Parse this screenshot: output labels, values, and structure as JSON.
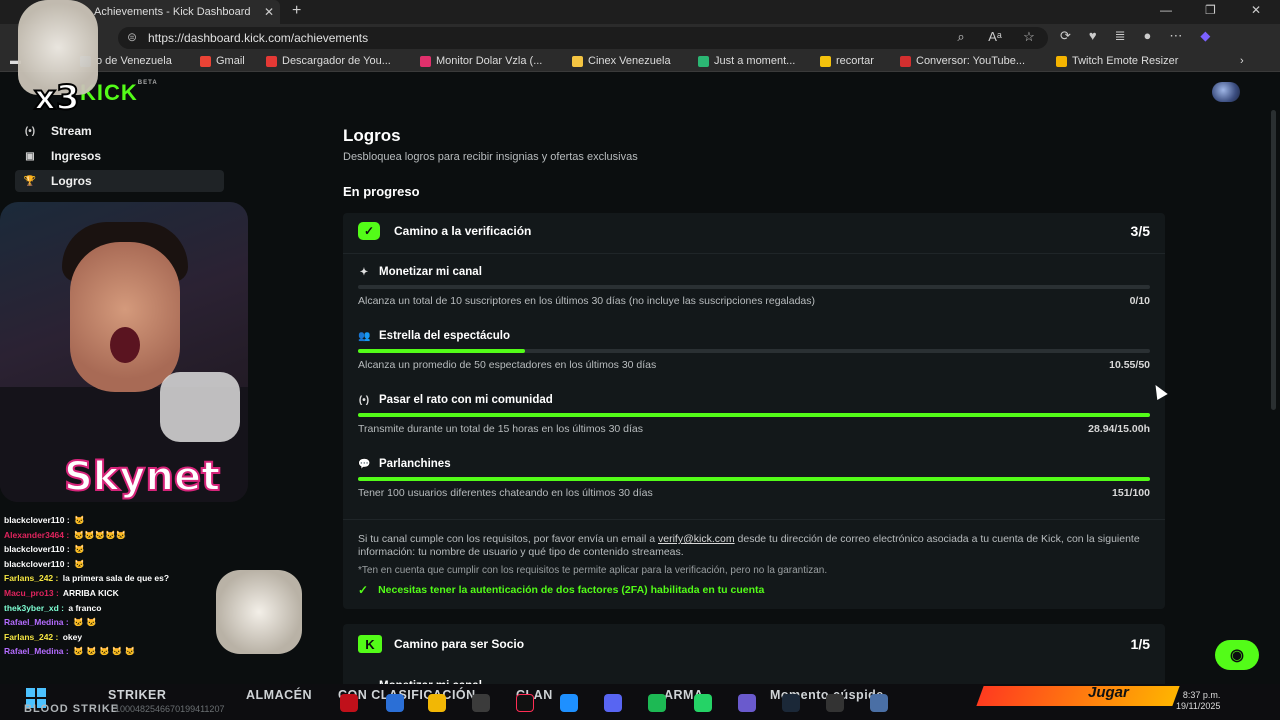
{
  "browser": {
    "tab_title": "Achievements - Kick Dashboard",
    "tab_close": "✕",
    "new_tab": "+",
    "url": "https://dashboard.kick.com/achievements",
    "bookmarks": [
      {
        "label": "o de Venezuela",
        "color": "#3a7bd5"
      },
      {
        "label": "Gmail",
        "color": "#ea4335"
      },
      {
        "label": "Descargador de You...",
        "color": "#e53935"
      },
      {
        "label": "Monitor Dolar Vzla (...",
        "color": "#e1306c"
      },
      {
        "label": "Cinex Venezuela",
        "color": "#f5c542"
      },
      {
        "label": "Just a moment...",
        "color": "#2bb673"
      },
      {
        "label": "recortar",
        "color": "#f4c20d"
      },
      {
        "label": "Conversor: YouTube...",
        "color": "#d32f2f"
      },
      {
        "label": "Twitch Emote Resizer",
        "color": "#f4b400"
      }
    ]
  },
  "sidebar": {
    "brand": "KICK",
    "brand_tag": "BETA",
    "items": [
      {
        "label": "Stream",
        "icon": "broadcast-icon",
        "glyph": "(•)"
      },
      {
        "label": "Ingresos",
        "icon": "income-icon",
        "glyph": "▣"
      },
      {
        "label": "Logros",
        "icon": "trophy-icon",
        "glyph": "🏆",
        "active": true
      }
    ]
  },
  "main": {
    "title": "Logros",
    "subtitle": "Desbloquea logros para recibir insignias y ofertas exclusivas",
    "section": "En progreso",
    "card1": {
      "title": "Camino a la verificación",
      "count": "3/5",
      "achievements": [
        {
          "title": "Monetizar mi canal",
          "icon": "sparkle-icon",
          "glyph": "✦",
          "progress": 0.0,
          "desc": "Alcanza un total de 10 suscriptores en los últimos 30 días (no incluye las suscripciones regaladas)",
          "value": "0/10"
        },
        {
          "title": "Estrella del espectáculo",
          "icon": "users-icon",
          "glyph": "👥",
          "progress": 0.211,
          "desc": "Alcanza un promedio de 50 espectadores en los últimos 30 días",
          "value": "10.55/50"
        },
        {
          "title": "Pasar el rato con mi comunidad",
          "icon": "broadcast-icon",
          "glyph": "(•)",
          "progress": 1.0,
          "desc": "Transmite durante un total de 15 horas en los últimos 30 días",
          "value": "28.94/15.00h"
        },
        {
          "title": "Parlanchines",
          "icon": "chat-bubble-icon",
          "glyph": "💬",
          "progress": 1.0,
          "desc": "Tener 100 usuarios diferentes chateando en los últimos 30 días",
          "value": "151/100"
        }
      ],
      "note_before": "Si tu canal cumple con los requisitos, por favor envía un email a ",
      "note_link": "verify@kick.com",
      "note_after": " desde tu dirección de correo electrónico asociada a tu cuenta de Kick, con la siguiente información: tu nombre de usuario y qué tipo de contenido streameas.",
      "note2": "*Ten en cuenta que cumplir con los requisitos te permite aplicar para la verificación, pero no la garantizan.",
      "requirement": "Necesitas tener la autenticación de dos factores (2FA) habilitada en tu cuenta"
    },
    "card2": {
      "title": "Camino para ser Socio",
      "count": "1/5",
      "first_item": "Monetizar mi canal"
    }
  },
  "overlay": {
    "x3": "x3",
    "skynet": "Skynet",
    "chat": [
      {
        "user": "blackclover110 :",
        "color": "#ffffff",
        "msg": "🐱"
      },
      {
        "user": "Alexander3464 :",
        "color": "#e0245e",
        "msg": "🐱🐱🐱🐱🐱"
      },
      {
        "user": "blackclover110 :",
        "color": "#ffffff",
        "msg": "🐱"
      },
      {
        "user": "blackclover110 :",
        "color": "#ffffff",
        "msg": "🐱"
      },
      {
        "user": "Farlans_242 :",
        "color": "#f5e642",
        "msg": "la primera sala de que es?"
      },
      {
        "user": "Macu_pro13 :",
        "color": "#e0245e",
        "msg": "ARRIBA KICK"
      },
      {
        "user": "thek3yber_xd :",
        "color": "#7fffd4",
        "msg": "a franco"
      },
      {
        "user": "Rafael_Medina :",
        "color": "#b46cff",
        "msg": "🐱 🐱"
      },
      {
        "user": "Farlans_242 :",
        "color": "#f5e642",
        "msg": "okey"
      },
      {
        "user": "Rafael_Medina :",
        "color": "#b46cff",
        "msg": "🐱 🐱 🐱 🐱 🐱"
      }
    ]
  },
  "taskbar": {
    "items": [
      "STRIKER",
      "ALMACÉN",
      "CON CLASIFICACIÓN",
      "CLAN",
      "ARMA",
      "Momento cúspide"
    ],
    "sub": "BLOOD STRIKE",
    "code": "1000482546670199411207",
    "jugar": "Jugar",
    "time": "8:37 p.m.",
    "date": "19/11/2025"
  }
}
